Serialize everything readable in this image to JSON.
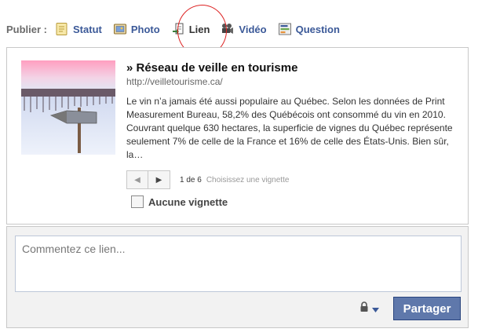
{
  "publisher": {
    "label": "Publier :",
    "tabs": [
      {
        "label": "Statut",
        "icon": "status-note-icon"
      },
      {
        "label": "Photo",
        "icon": "photo-icon"
      },
      {
        "label": "Lien",
        "icon": "link-icon",
        "active": true
      },
      {
        "label": "Vidéo",
        "icon": "video-camera-icon"
      },
      {
        "label": "Question",
        "icon": "question-poll-icon"
      }
    ]
  },
  "link": {
    "title": "» Réseau de veille en tourisme",
    "url": "http://veilletourisme.ca/",
    "description": "Le vin n’a jamais été aussi populaire au Québec. Selon les données de Print Measurement Bureau, 58,2% des Québécois ont consommé du vin en 2010. Couvrant quelque 630 hectares, la superficie de vignes du Québec représente seulement 7% de celle de la France et 16% de celle des États-Unis. Bien sûr, la…"
  },
  "thumbnail_pager": {
    "count": "1 de 6",
    "hint": "Choisissez une vignette"
  },
  "no_thumbnail": {
    "label": "Aucune vignette",
    "checked": false
  },
  "comment": {
    "placeholder": "Commentez ce lien..."
  },
  "share_button": "Partager",
  "colors": {
    "link_blue": "#3b5998",
    "share_button": "#5f78ab",
    "highlight_circle": "#dd2222"
  }
}
